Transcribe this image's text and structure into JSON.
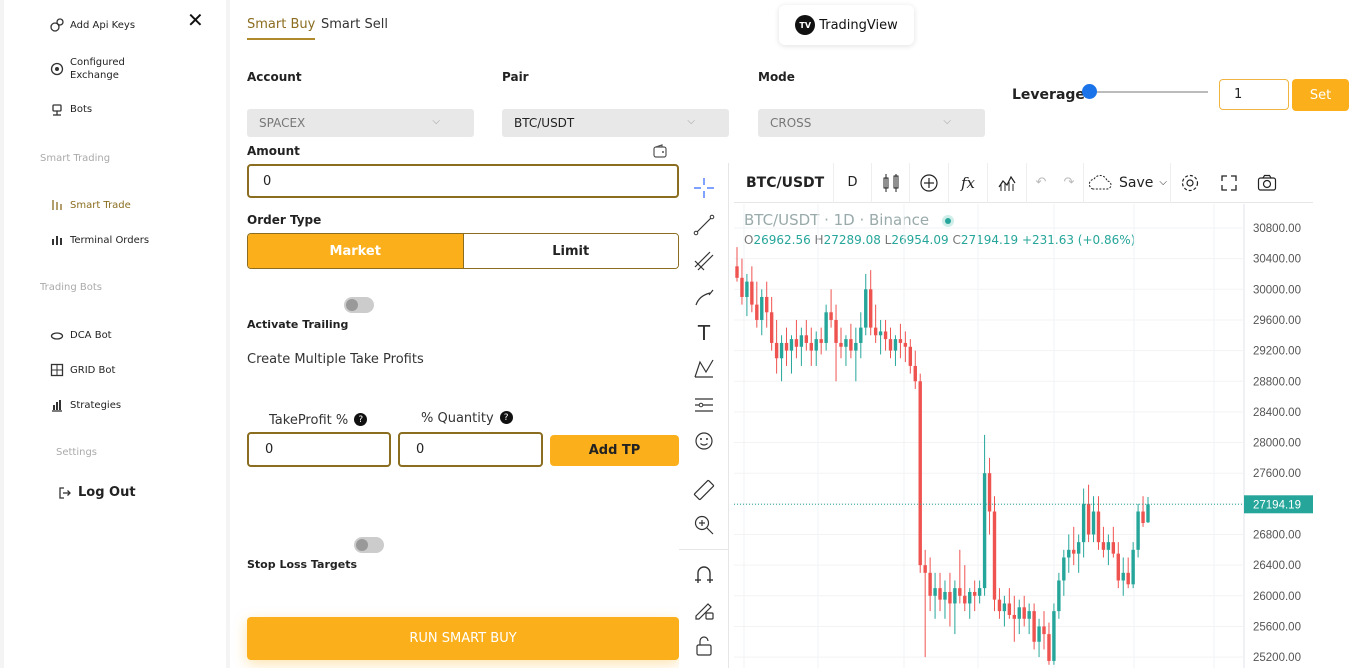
{
  "sidebar": {
    "items": [
      {
        "label": "Add Api Keys",
        "icon": "key-coin-icon"
      },
      {
        "label": "Configured\nExchange",
        "icon": "exchange-icon"
      },
      {
        "label": "Bots",
        "icon": "bot-icon"
      },
      {
        "label": "Smart Trade",
        "icon": "smart-trade-icon"
      },
      {
        "label": "Terminal Orders",
        "icon": "terminal-orders-icon"
      },
      {
        "label": "DCA Bot",
        "icon": "dca-bot-icon"
      },
      {
        "label": "GRID Bot",
        "icon": "grid-bot-icon"
      },
      {
        "label": "Strategies",
        "icon": "strategies-icon"
      }
    ],
    "section_smart_trading": "Smart Trading",
    "section_trading_bots": "Trading Bots",
    "section_settings": "Settings",
    "logout_label": "Log Out",
    "active_color": "#8a6d1f"
  },
  "tabs": {
    "smart_buy": "Smart Buy",
    "smart_sell": "Smart Sell"
  },
  "tradingview_label": "TradingView",
  "form": {
    "account_label": "Account",
    "account_value": "SPACEX",
    "pair_label": "Pair",
    "pair_value": "BTC/USDT",
    "mode_label": "Mode",
    "mode_value": "CROSS",
    "leverage_label": "Leverage",
    "leverage_value": "1",
    "set_label": "Set",
    "amount_label": "Amount",
    "amount_value": "0",
    "order_type_label": "Order Type",
    "market_label": "Market",
    "limit_label": "Limit",
    "activate_trailing_label": "Activate Trailing",
    "multiple_tp_label": "Create Multiple Take Profits",
    "takeprofit_label": "TakeProfit %",
    "quantity_label": "% Quantity",
    "takeprofit_value": "0",
    "quantity_value": "0",
    "add_tp_label": "Add TP",
    "stop_loss_label": "Stop Loss Targets",
    "run_label": "RUN SMART BUY",
    "accent": "#fbb01b"
  },
  "chart": {
    "symbol": "BTC/USDT",
    "interval": "D",
    "save_label": "Save",
    "legend_title": "BTC/USDT · 1D · Binance",
    "ohlc": {
      "o_label": "O",
      "o": "26962.56",
      "h_label": "H",
      "h": "27289.08",
      "l_label": "L",
      "l": "26954.09",
      "c_label": "C",
      "c": "27194.19",
      "chg": "+231.63 (+0.86%)"
    },
    "last_price": "27194.19",
    "up_color": "#26a69a",
    "down_color": "#ef5350",
    "price_ticks": [
      "30800.00",
      "30400.00",
      "30000.00",
      "29600.00",
      "29200.00",
      "28800.00",
      "28400.00",
      "28000.00",
      "27600.00",
      "27200.00",
      "26800.00",
      "26400.00",
      "26000.00",
      "25600.00",
      "25200.00"
    ]
  },
  "chart_data": {
    "type": "candlestick",
    "ylim": [
      25000,
      31000
    ],
    "candles": [
      {
        "o": 30300,
        "h": 30550,
        "l": 30100,
        "c": 30150
      },
      {
        "o": 30150,
        "h": 30400,
        "l": 29800,
        "c": 29900
      },
      {
        "o": 29900,
        "h": 30200,
        "l": 29650,
        "c": 30100
      },
      {
        "o": 30100,
        "h": 30300,
        "l": 29700,
        "c": 29800
      },
      {
        "o": 29800,
        "h": 30100,
        "l": 29500,
        "c": 29600
      },
      {
        "o": 29600,
        "h": 30000,
        "l": 29400,
        "c": 29900
      },
      {
        "o": 29900,
        "h": 30100,
        "l": 29500,
        "c": 29700
      },
      {
        "o": 29700,
        "h": 29900,
        "l": 29200,
        "c": 29300
      },
      {
        "o": 29300,
        "h": 29600,
        "l": 28900,
        "c": 29100
      },
      {
        "o": 29100,
        "h": 29400,
        "l": 28800,
        "c": 29300
      },
      {
        "o": 29300,
        "h": 29500,
        "l": 29000,
        "c": 29200
      },
      {
        "o": 29200,
        "h": 29400,
        "l": 28900,
        "c": 29350
      },
      {
        "o": 29350,
        "h": 29600,
        "l": 29100,
        "c": 29250
      },
      {
        "o": 29250,
        "h": 29500,
        "l": 29000,
        "c": 29400
      },
      {
        "o": 29400,
        "h": 29600,
        "l": 29200,
        "c": 29300
      },
      {
        "o": 29300,
        "h": 29500,
        "l": 29000,
        "c": 29200
      },
      {
        "o": 29200,
        "h": 29450,
        "l": 29000,
        "c": 29350
      },
      {
        "o": 29350,
        "h": 29500,
        "l": 29150,
        "c": 29300
      },
      {
        "o": 29300,
        "h": 29800,
        "l": 29200,
        "c": 29700
      },
      {
        "o": 29700,
        "h": 30000,
        "l": 29500,
        "c": 29600
      },
      {
        "o": 29600,
        "h": 29800,
        "l": 28800,
        "c": 29300
      },
      {
        "o": 29300,
        "h": 29500,
        "l": 29100,
        "c": 29250
      },
      {
        "o": 29250,
        "h": 29400,
        "l": 29000,
        "c": 29350
      },
      {
        "o": 29350,
        "h": 29550,
        "l": 29100,
        "c": 29200
      },
      {
        "o": 29200,
        "h": 29500,
        "l": 28800,
        "c": 29300
      },
      {
        "o": 29300,
        "h": 29700,
        "l": 29100,
        "c": 29500
      },
      {
        "o": 29500,
        "h": 30200,
        "l": 29400,
        "c": 30000
      },
      {
        "o": 30000,
        "h": 30250,
        "l": 29400,
        "c": 29500
      },
      {
        "o": 29500,
        "h": 29800,
        "l": 29300,
        "c": 29400
      },
      {
        "o": 29400,
        "h": 29600,
        "l": 29150,
        "c": 29450
      },
      {
        "o": 29450,
        "h": 29600,
        "l": 29200,
        "c": 29350
      },
      {
        "o": 29350,
        "h": 29500,
        "l": 29100,
        "c": 29200
      },
      {
        "o": 29200,
        "h": 29400,
        "l": 29000,
        "c": 29350
      },
      {
        "o": 29350,
        "h": 29550,
        "l": 29100,
        "c": 29300
      },
      {
        "o": 29300,
        "h": 29450,
        "l": 29050,
        "c": 29250
      },
      {
        "o": 29250,
        "h": 29350,
        "l": 28900,
        "c": 29000
      },
      {
        "o": 29000,
        "h": 29200,
        "l": 28700,
        "c": 28800
      },
      {
        "o": 28800,
        "h": 28900,
        "l": 26300,
        "c": 26400
      },
      {
        "o": 26400,
        "h": 26600,
        "l": 25200,
        "c": 26300
      },
      {
        "o": 26300,
        "h": 26500,
        "l": 25800,
        "c": 26000
      },
      {
        "o": 26000,
        "h": 26300,
        "l": 25700,
        "c": 26100
      },
      {
        "o": 26100,
        "h": 26300,
        "l": 25800,
        "c": 25950
      },
      {
        "o": 25950,
        "h": 26200,
        "l": 25700,
        "c": 26050
      },
      {
        "o": 26050,
        "h": 26300,
        "l": 25600,
        "c": 25900
      },
      {
        "o": 25900,
        "h": 26200,
        "l": 25500,
        "c": 26100
      },
      {
        "o": 26100,
        "h": 26600,
        "l": 25900,
        "c": 26000
      },
      {
        "o": 26000,
        "h": 26400,
        "l": 25800,
        "c": 25900
      },
      {
        "o": 25900,
        "h": 26100,
        "l": 25700,
        "c": 26050
      },
      {
        "o": 26050,
        "h": 26200,
        "l": 25800,
        "c": 26000
      },
      {
        "o": 26000,
        "h": 26200,
        "l": 25900,
        "c": 26100
      },
      {
        "o": 26100,
        "h": 28100,
        "l": 26000,
        "c": 27600
      },
      {
        "o": 27600,
        "h": 27800,
        "l": 26800,
        "c": 27100
      },
      {
        "o": 27100,
        "h": 27300,
        "l": 25800,
        "c": 25950
      },
      {
        "o": 25950,
        "h": 26100,
        "l": 25700,
        "c": 25800
      },
      {
        "o": 25800,
        "h": 26000,
        "l": 25600,
        "c": 25900
      },
      {
        "o": 25900,
        "h": 26100,
        "l": 25700,
        "c": 25750
      },
      {
        "o": 25750,
        "h": 26000,
        "l": 25400,
        "c": 25700
      },
      {
        "o": 25700,
        "h": 25950,
        "l": 25500,
        "c": 25850
      },
      {
        "o": 25850,
        "h": 26000,
        "l": 25600,
        "c": 25700
      },
      {
        "o": 25700,
        "h": 25900,
        "l": 25500,
        "c": 25800
      },
      {
        "o": 25800,
        "h": 25900,
        "l": 25300,
        "c": 25400
      },
      {
        "o": 25400,
        "h": 25700,
        "l": 25200,
        "c": 25600
      },
      {
        "o": 25600,
        "h": 25800,
        "l": 25300,
        "c": 25500
      },
      {
        "o": 25500,
        "h": 25650,
        "l": 25100,
        "c": 25150
      },
      {
        "o": 25150,
        "h": 25900,
        "l": 25100,
        "c": 25800
      },
      {
        "o": 25800,
        "h": 26300,
        "l": 25700,
        "c": 26200
      },
      {
        "o": 26200,
        "h": 26600,
        "l": 26000,
        "c": 26500
      },
      {
        "o": 26500,
        "h": 26800,
        "l": 26300,
        "c": 26600
      },
      {
        "o": 26600,
        "h": 26900,
        "l": 26400,
        "c": 26550
      },
      {
        "o": 26550,
        "h": 26800,
        "l": 26300,
        "c": 26700
      },
      {
        "o": 26700,
        "h": 27400,
        "l": 26500,
        "c": 27200
      },
      {
        "o": 27200,
        "h": 27450,
        "l": 26700,
        "c": 26800
      },
      {
        "o": 26800,
        "h": 27300,
        "l": 26700,
        "c": 27100
      },
      {
        "o": 27100,
        "h": 27300,
        "l": 26600,
        "c": 26700
      },
      {
        "o": 26700,
        "h": 26900,
        "l": 26500,
        "c": 26600
      },
      {
        "o": 26600,
        "h": 26800,
        "l": 26400,
        "c": 26700
      },
      {
        "o": 26700,
        "h": 26900,
        "l": 26500,
        "c": 26550
      },
      {
        "o": 26550,
        "h": 26700,
        "l": 26100,
        "c": 26200
      },
      {
        "o": 26200,
        "h": 26500,
        "l": 26000,
        "c": 26300
      },
      {
        "o": 26300,
        "h": 26500,
        "l": 26100,
        "c": 26150
      },
      {
        "o": 26150,
        "h": 26700,
        "l": 26100,
        "c": 26600
      },
      {
        "o": 26600,
        "h": 27200,
        "l": 26500,
        "c": 27100
      },
      {
        "o": 27100,
        "h": 27300,
        "l": 26900,
        "c": 26950
      },
      {
        "o": 26960,
        "h": 27290,
        "l": 26950,
        "c": 27194
      }
    ]
  }
}
